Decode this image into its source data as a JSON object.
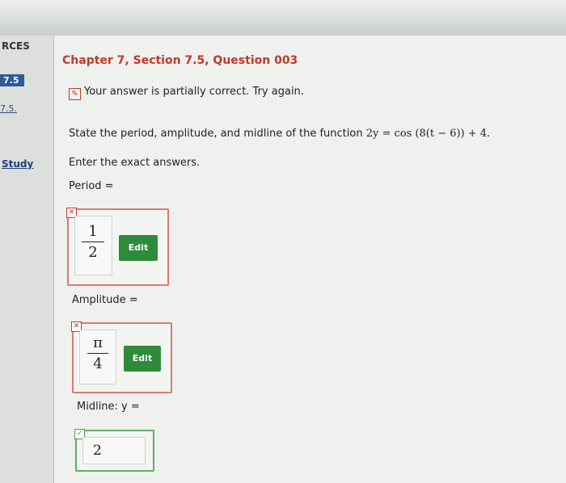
{
  "sidebar": {
    "heading": "RCES",
    "pill": "7.5",
    "link": "7.5.",
    "study": "Study"
  },
  "main": {
    "title": "Chapter 7, Section 7.5, Question 003",
    "status": "Your answer is partially correct.  Try again.",
    "question_prefix": "State the period, amplitude, and midline of the function ",
    "question_math": "2y = cos (8(t − 6)) + 4.",
    "instructions": "Enter the exact answers.",
    "period": {
      "label": "Period =",
      "numerator": "1",
      "denominator": "2",
      "edit": "Edit",
      "mark": "✕"
    },
    "amplitude": {
      "label": "Amplitude =",
      "numerator": "π",
      "denominator": "4",
      "edit": "Edit",
      "mark": "✕"
    },
    "midline": {
      "label": "Midline:  y =",
      "value": "2",
      "mark": "✓"
    }
  },
  "colors": {
    "title": "#c0392b",
    "edit": "#2e8b3a",
    "wrong_border": "#d97b70",
    "correct_border": "#5fae6b"
  }
}
